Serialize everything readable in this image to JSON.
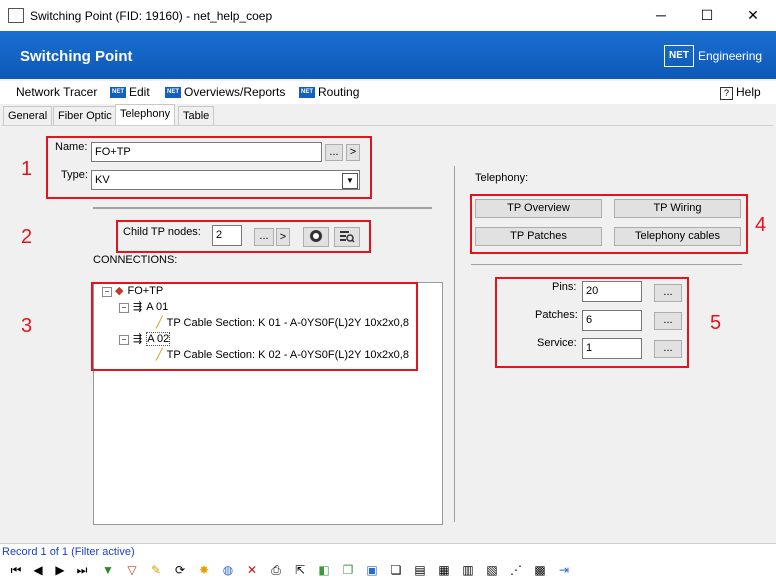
{
  "window": {
    "title": "Switching Point (FID: 19160) - net_help_coep",
    "minimize": "─",
    "maximize": "☐",
    "close": "✕"
  },
  "header": {
    "title": "Switching Point",
    "logo_text": "NET",
    "brand": "Engineering"
  },
  "menu": {
    "items": [
      "Network Tracer",
      "Edit",
      "Overviews/Reports",
      "Routing"
    ],
    "help": "Help",
    "help_icon": "?"
  },
  "tabs": [
    "General",
    "Fiber Optic",
    "Telephony",
    "Table"
  ],
  "form": {
    "name_label": "Name:",
    "name_value": "FO+TP",
    "type_label": "Type:",
    "type_value": "KV",
    "child_label": "Child TP nodes:",
    "child_value": "2",
    "connections_label": "CONNECTIONS:",
    "browse": "...",
    "go": ">"
  },
  "tree": {
    "root": "FO+TP",
    "nodes": [
      {
        "label": "A 01",
        "child": "TP Cable Section: K 01 - A-0YS0F(L)2Y 10x2x0,8"
      },
      {
        "label": "A 02",
        "child": "TP Cable Section: K 02 - A-0YS0F(L)2Y 10x2x0,8"
      }
    ]
  },
  "telephony": {
    "label": "Telephony:",
    "buttons": [
      "TP Overview",
      "TP Wiring",
      "TP Patches",
      "Telephony cables"
    ],
    "pins_label": "Pins:",
    "pins_value": "20",
    "patches_label": "Patches:",
    "patches_value": "6",
    "service_label": "Service:",
    "service_value": "1"
  },
  "annotations": [
    "1",
    "2",
    "3",
    "4",
    "5"
  ],
  "status": {
    "record": "Record 1 of 1 (Filter active)"
  },
  "colors": {
    "header": "#1466c8",
    "annotation": "#e3141b",
    "link": "#1a3fd0"
  }
}
